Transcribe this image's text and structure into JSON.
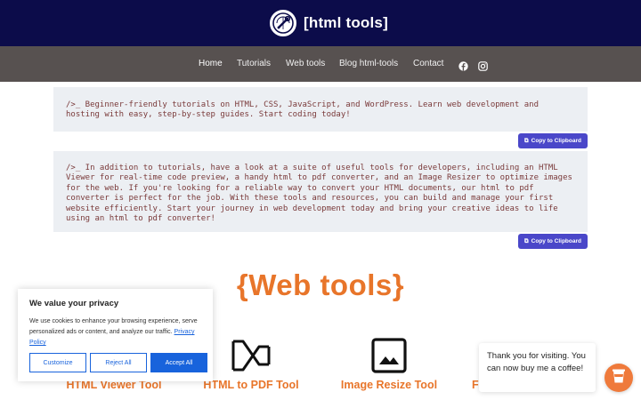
{
  "header": {
    "brand": "[html tools]",
    "logo_icon": "wrench-globe-icon",
    "colors": {
      "topbar": "#0c0c4a",
      "navbar": "#575150"
    }
  },
  "nav": {
    "items": [
      {
        "label": "Home",
        "active": true
      },
      {
        "label": "Tutorials"
      },
      {
        "label": "Web tools"
      },
      {
        "label": "Blog html-tools"
      },
      {
        "label": "Contact"
      }
    ],
    "social": [
      "facebook-icon",
      "instagram-icon"
    ]
  },
  "intro": {
    "box1": "/>_ Beginner-friendly tutorials on HTML, CSS, JavaScript, and WordPress. Learn web development and hosting with easy, step-by-step guides. Start coding today!",
    "box2": "/>_ In addition to tutorials, have a look at a suite of useful tools for developers, including an HTML Viewer for real-time code preview, a handy html to pdf converter, and an Image Resizer to optimize images for the web. If you're looking for a reliable way to convert your HTML documents, our html to pdf converter is perfect for the job. With these tools and resources, you can build and manage your first website efficiently. Start your journey in web development today and bring your creative ideas to life using an html to pdf converter!",
    "copy_label": "Copy to Clipboard"
  },
  "tools": {
    "title": "{Web tools}",
    "accent": "#e8752a",
    "items": [
      {
        "label": "HTML Viewer Tool"
      },
      {
        "label": "HTML to PDF Tool"
      },
      {
        "label": "Image Resize Tool"
      },
      {
        "label": "Fi"
      }
    ]
  },
  "cookie": {
    "title": "We value your privacy",
    "text": "We use cookies to enhance your browsing experience, serve personalized ads or content, and analyze our traffic.",
    "policy_link": "Privacy Policy",
    "customize": "Customize",
    "reject": "Reject All",
    "accept": "Accept All"
  },
  "chat": {
    "message": "Thank you for visiting. You can now buy me a coffee!"
  }
}
